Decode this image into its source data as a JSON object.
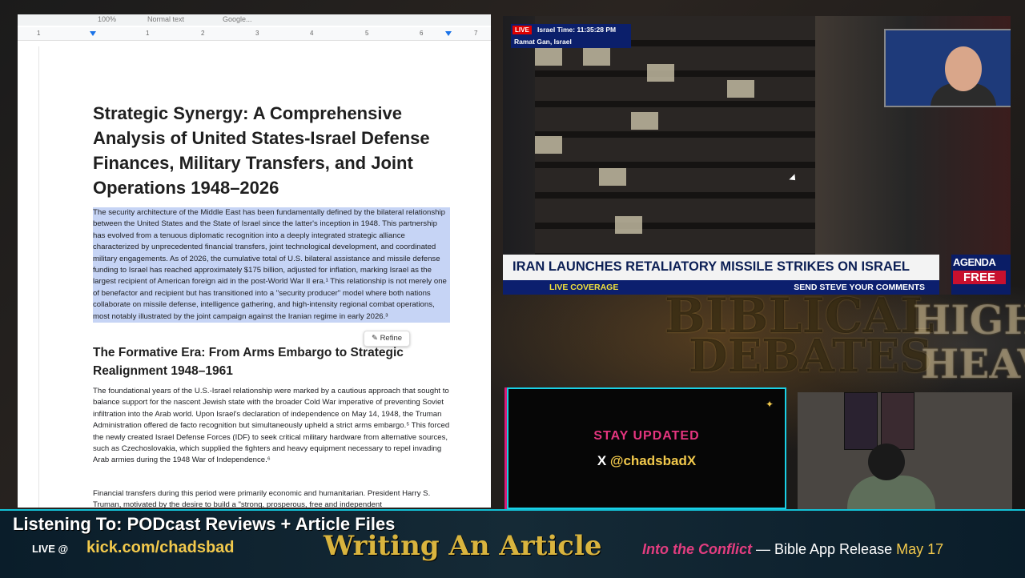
{
  "doc": {
    "toolbar": {
      "zoom": "100%",
      "style": "Normal text",
      "font": "Google..."
    },
    "ruler_ticks": [
      "1",
      "1",
      "2",
      "3",
      "4",
      "5",
      "6",
      "7"
    ],
    "title": "Strategic Synergy: A Comprehensive Analysis of United States-Israel Defense Finances, Military Transfers, and Joint Operations 1948–2026",
    "intro": "The security architecture of the Middle East has been fundamentally defined by the bilateral relationship between the United States and the State of Israel since the latter's inception in 1948. This partnership has evolved from a tenuous diplomatic recognition into a deeply integrated strategic alliance characterized by unprecedented financial transfers, joint technological development, and coordinated military engagements. As of 2026, the cumulative total of U.S. bilateral assistance and missile defense funding to Israel has reached approximately $175 billion, adjusted for inflation, marking Israel as the largest recipient of American foreign aid in the post-World War II era.¹ This relationship is not merely one of benefactor and recipient but has transitioned into a \"security producer\" model where both nations collaborate on missile defense, intelligence gathering, and high-intensity regional combat operations, most notably illustrated by the joint campaign against the Iranian regime in early 2026.³",
    "refine_label": "Refine",
    "section_heading": "The Formative Era: From Arms Embargo to Strategic Realignment 1948–1961",
    "para2": "The foundational years of the U.S.-Israel relationship were marked by a cautious approach that sought to balance support for the nascent Jewish state with the broader Cold War imperative of preventing Soviet infiltration into the Arab world. Upon Israel's declaration of independence on May 14, 1948, the Truman Administration offered de facto recognition but simultaneously upheld a strict arms embargo.⁵ This forced the newly created Israel Defense Forces (IDF) to seek critical military hardware from alternative sources, such as Czechoslovakia, which supplied the fighters and heavy equipment necessary to repel invading Arab armies during the 1948 War of Independence.⁶",
    "para3": "Financial transfers during this period were primarily economic and humanitarian. President Harry S. Truman, motivated by the desire to build a \"strong, prosperous, free and independent"
  },
  "news": {
    "live_tag": "LIVE",
    "time": "Israel Time: 11:35:28 PM",
    "location": "Ramat Gan, Israel",
    "headline": "IRAN LAUNCHES RETALIATORY MISSILE STRIKES ON ISRAEL",
    "sub_left": "LIVE COVERAGE",
    "sub_right": "SEND STEVE YOUR COMMENTS",
    "brand_top": "AGENDA",
    "brand_bottom": "FREE"
  },
  "background": {
    "graffiti1": "BIBLICAL",
    "graffiti2": "DEBATES",
    "graffiti3": "HIGHE",
    "graffiti4": "HEAVE"
  },
  "stay": {
    "title": "STAY UPDATED",
    "prefix": "X ",
    "handle": "@chadsbadX"
  },
  "bottom": {
    "listening": "Listening To: PODcast Reviews + Article Files",
    "live_at": "LIVE @",
    "kick": "kick.com/chadsbad",
    "writing": "Writing An Article",
    "ticker_pink": "Into the Conflict",
    "ticker_mid": " — Bible App Release ",
    "ticker_gold": "May 17"
  }
}
